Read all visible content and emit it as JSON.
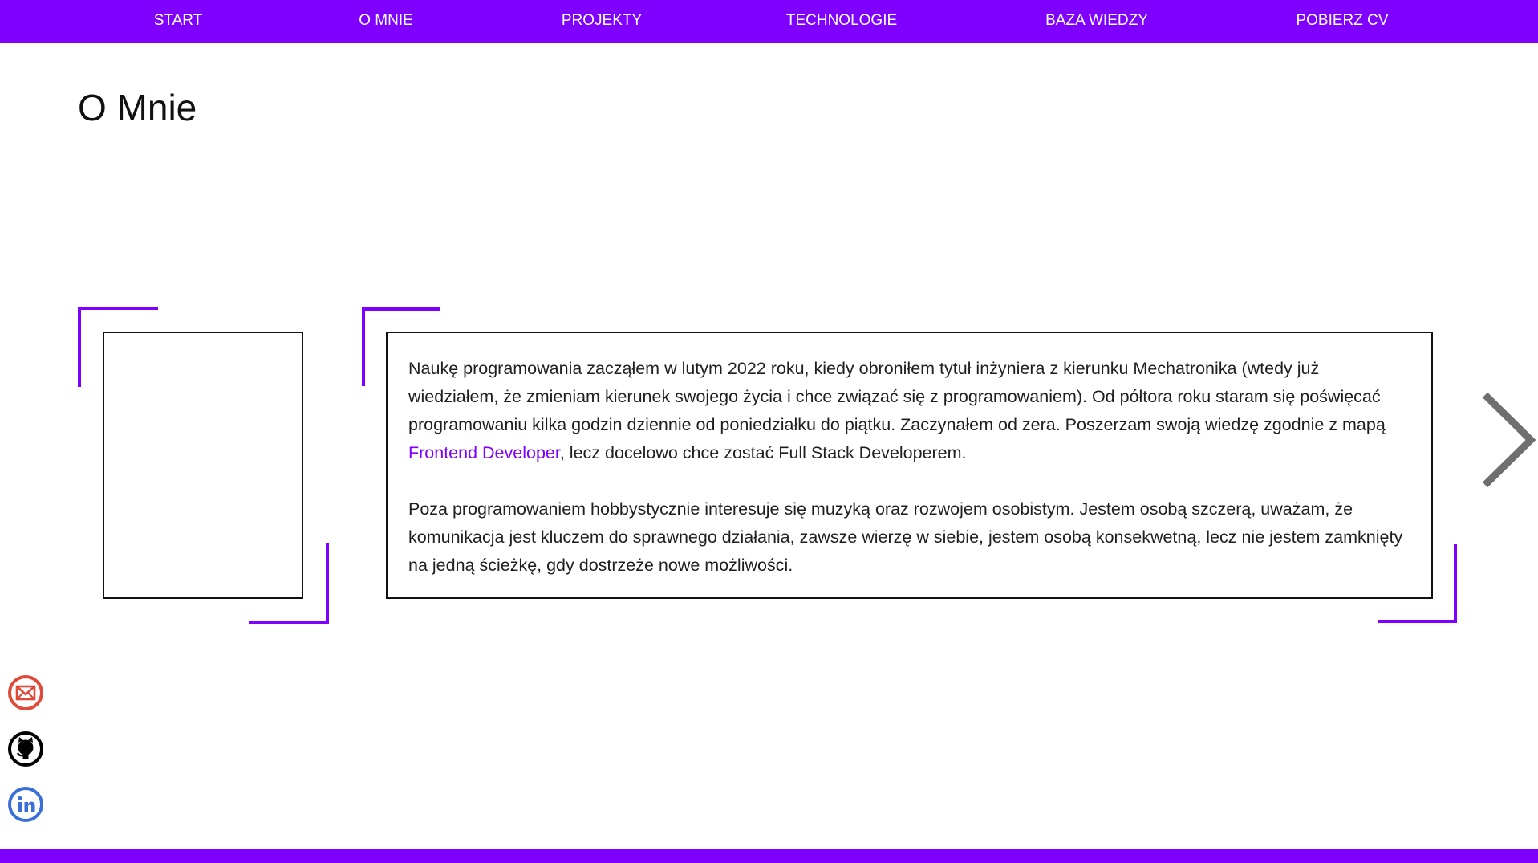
{
  "nav": {
    "items": [
      {
        "label": "START"
      },
      {
        "label": "O MNIE"
      },
      {
        "label": "PROJEKTY"
      },
      {
        "label": "TECHNOLOGIE"
      },
      {
        "label": "BAZA WIEDZY"
      },
      {
        "label": "POBIERZ CV"
      }
    ]
  },
  "about": {
    "title": "O Mnie",
    "p1_before_link": "Naukę programowania zacząłem w lutym 2022 roku, kiedy obroniłem tytuł inżyniera z kierunku Mechatronika (wtedy już wiedziałem, że zmieniam kierunek swojego życia i chce związać się z programowaniem). Od półtora roku staram się poświęcać programowaniu kilka godzin dziennie od poniedziałku do piątku. Zaczynałem od zera. Poszerzam swoją wiedzę zgodnie z mapą ",
    "p1_link": "Frontend Developer",
    "p1_after_link": ", lecz docelowo chce zostać Full Stack Developerem.",
    "p2": "Poza programowaniem hobbystycznie interesuje się muzyką oraz rozwojem osobistym. Jestem osobą szczerą, uważam, że komunikacja jest kluczem do sprawnego działania, zawsze wierzę w siebie, jestem osobą konsekwetną, lecz nie jestem zamknięty na jedną ścieżkę, gdy dostrzeże nowe możliwości."
  },
  "icons": {
    "next": "chevron-right-icon",
    "email": "email-icon",
    "github": "github-icon",
    "linkedin": "linkedin-icon"
  },
  "colors": {
    "accent": "#7f00ff",
    "email": "#e04a3a",
    "github": "#000000",
    "linkedin": "#3a6fd8",
    "arrow": "#6f6f6f"
  }
}
